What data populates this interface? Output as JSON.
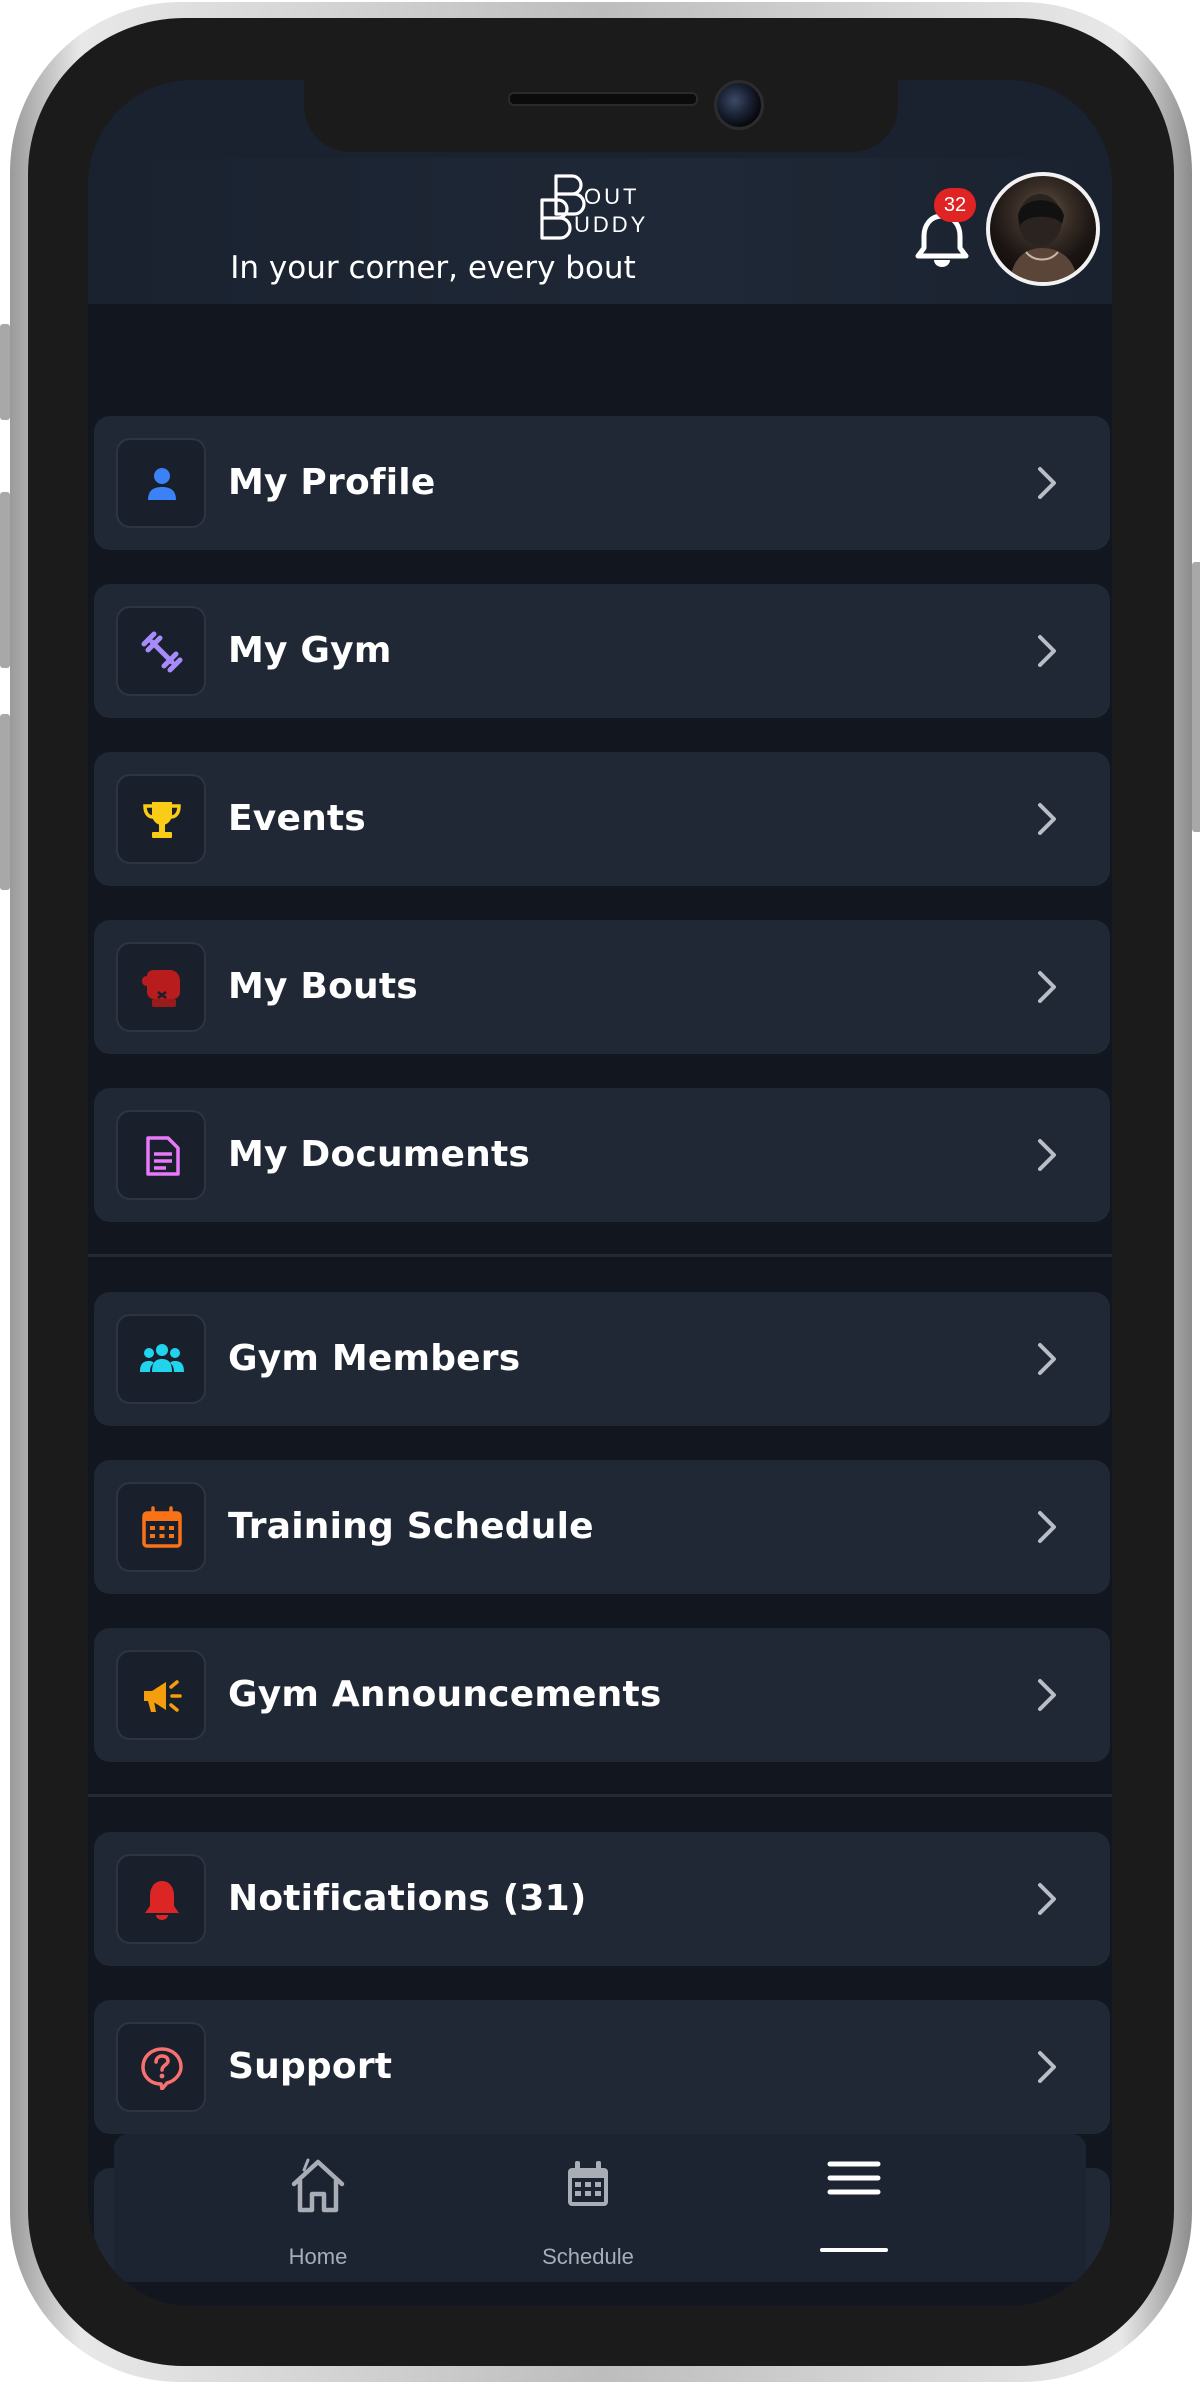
{
  "header": {
    "tagline": "In your corner, every bout",
    "logo_text": "Bout Buddy",
    "notification_count": "32"
  },
  "menu": {
    "items": [
      {
        "label": "My Profile",
        "icon": "person-icon",
        "icon_color": "#3b82f6"
      },
      {
        "label": "My Gym",
        "icon": "dumbbell-icon",
        "icon_color": "#a78bfa"
      },
      {
        "label": "Events",
        "icon": "trophy-icon",
        "icon_color": "#facc15"
      },
      {
        "label": "My Bouts",
        "icon": "boxing-glove-icon",
        "icon_color": "#b91c1c"
      },
      {
        "label": "My Documents",
        "icon": "document-icon",
        "icon_color": "#e879f9"
      },
      {
        "label": "Gym Members",
        "icon": "users-icon",
        "icon_color": "#22d3ee"
      },
      {
        "label": "Training Schedule",
        "icon": "calendar-icon",
        "icon_color": "#f97316"
      },
      {
        "label": "Gym Announcements",
        "icon": "megaphone-icon",
        "icon_color": "#f59e0b"
      },
      {
        "label": "Notifications (31)",
        "icon": "bell-icon",
        "icon_color": "#dc2626"
      },
      {
        "label": "Support",
        "icon": "help-icon",
        "icon_color": "#f87171"
      }
    ]
  },
  "bottom_nav": {
    "items": [
      {
        "label": "Home",
        "icon": "home-icon"
      },
      {
        "label": "Schedule",
        "icon": "calendar-icon"
      },
      {
        "label": "",
        "icon": "menu-icon",
        "active": true
      }
    ]
  },
  "colors": {
    "background": "#12161e",
    "card": "#212835",
    "badge": "#e02424"
  }
}
